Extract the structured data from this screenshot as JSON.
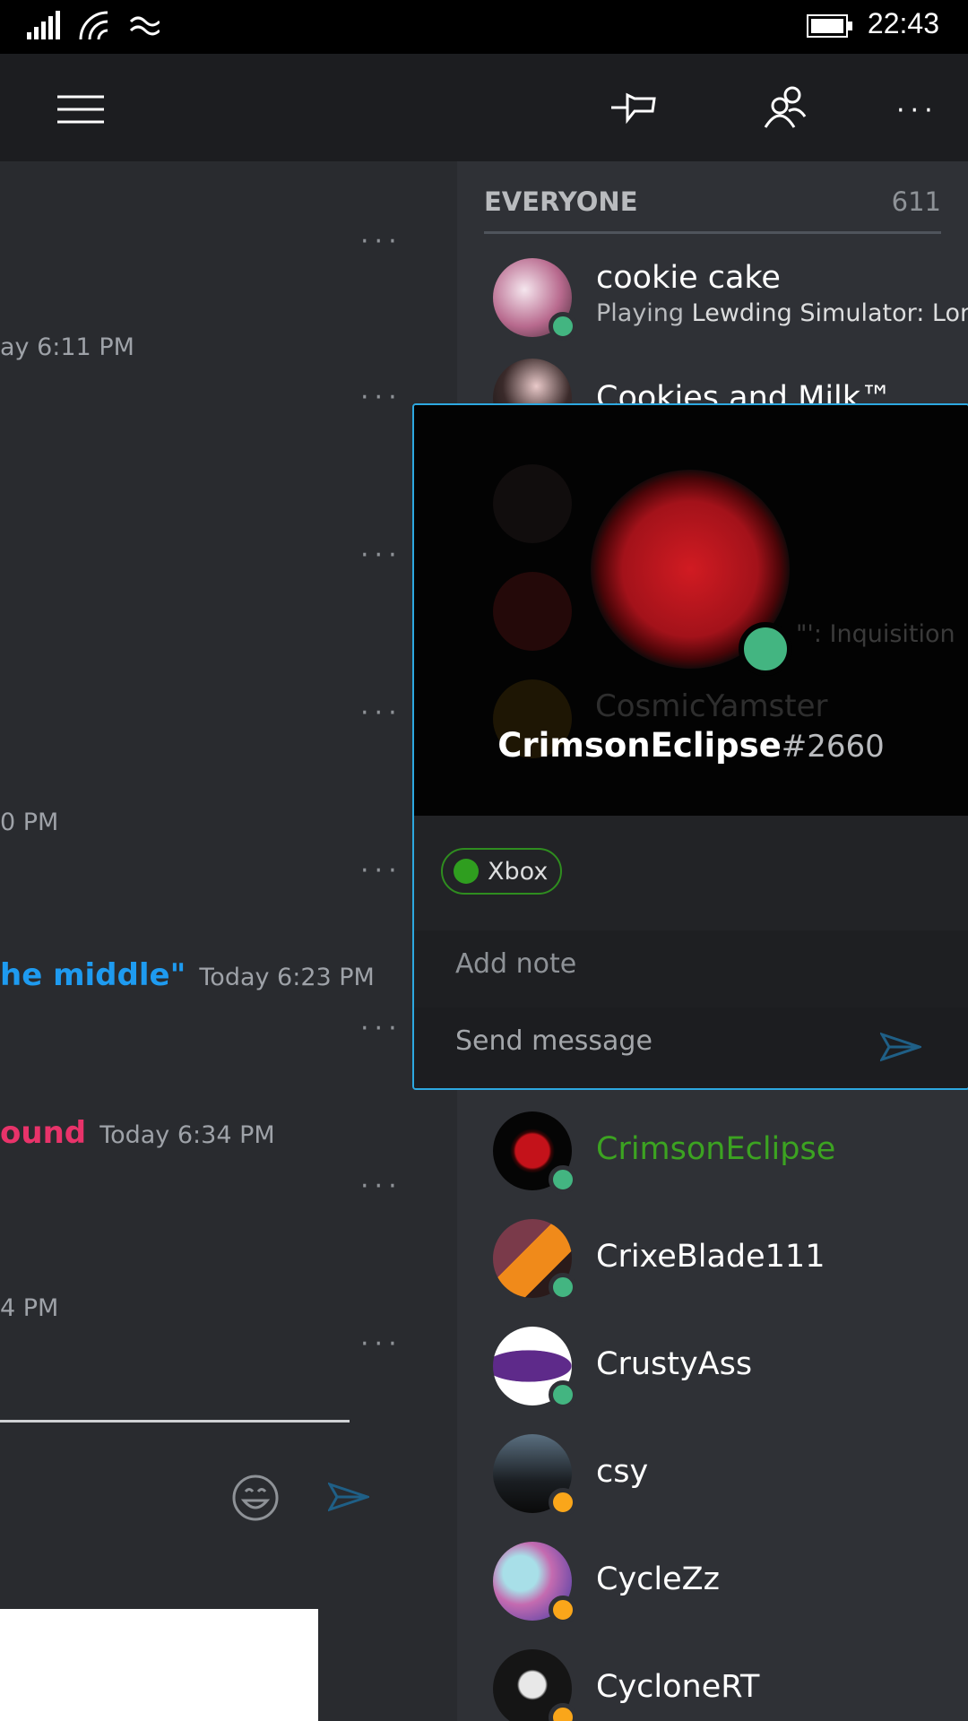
{
  "status_bar": {
    "time": "22:43"
  },
  "app_bar": {
    "menu_icon": "hamburger-icon",
    "pin_icon": "pin-icon",
    "members_icon": "people-icon",
    "more_icon": "more-dots-icon"
  },
  "chat": {
    "timestamps": [
      "ay 6:11 PM",
      "0 PM",
      "Today 6:23 PM",
      "Today 6:34 PM",
      "4 PM"
    ],
    "message_blue": "he middle\"",
    "message_pink": "ound",
    "more_label": "···",
    "emoji_icon": "emoji-icon",
    "send_icon": "send-icon"
  },
  "members": {
    "section_title": "EVERYONE",
    "section_count": "611",
    "list": [
      {
        "name": "cookie cake",
        "status": "online",
        "activity_prefix": "Playing",
        "activity": "Lewding Simulator: Londo"
      },
      {
        "name": "Cookies and Milk™",
        "status": "dnd"
      },
      {
        "name": "CrimsonEclipse",
        "status": "online"
      },
      {
        "name": "CrixeBlade111",
        "status": "online"
      },
      {
        "name": "CrustyAss",
        "status": "online"
      },
      {
        "name": "csy",
        "status": "idle"
      },
      {
        "name": "CycleZz",
        "status": "idle"
      },
      {
        "name": "CycloneRT",
        "status": "idle"
      }
    ],
    "behind_card": {
      "name_partial": "CosmicYamster",
      "activity_partial": "\"': Inquisition"
    }
  },
  "popout": {
    "username": "CrimsonEclipse",
    "discriminator": "#2660",
    "platform_label": "Xbox",
    "note_placeholder": "Add note",
    "message_placeholder": "Send message"
  },
  "colors": {
    "online": "#43b581",
    "idle": "#faa61a",
    "dnd": "#f04747",
    "accent": "#2da8e0",
    "crimson_name": "#3ca321"
  }
}
